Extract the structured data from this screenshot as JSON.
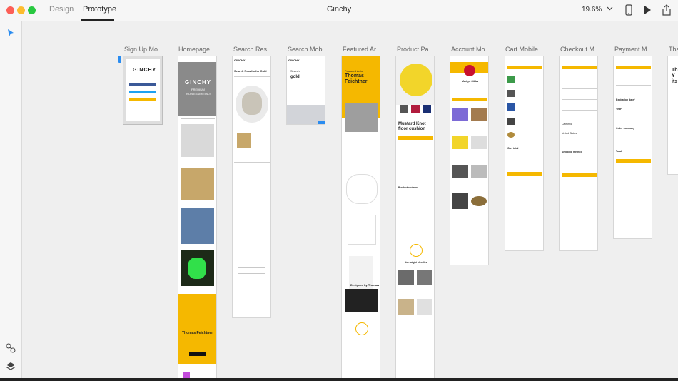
{
  "toolbar": {
    "design_tab": "Design",
    "prototype_tab": "Prototype",
    "document_title": "Ginchy",
    "zoom_level": "19.6%"
  },
  "icons": {
    "window_close": "red-circle",
    "window_minimize": "yellow-circle",
    "window_maximize": "green-circle",
    "zoom_dropdown": "chevron-down-icon",
    "device_preview": "phone-icon",
    "play": "play-icon",
    "share": "share-icon",
    "select_tool": "arrow-cursor-icon",
    "plugins": "plugins-icon",
    "layers": "layers-icon"
  },
  "artboards": [
    {
      "label": "Sign Up Mo...",
      "logo": "GINCHY"
    },
    {
      "label": "Homepage ...",
      "logo": "GINCHY",
      "hero": "GINCHY",
      "tagline": "PREMIUM",
      "tagline2": "NON-ESSENTIALS",
      "featured_name": "Thomas Feichtner"
    },
    {
      "label": "Search Res...",
      "logo": "GINCHY",
      "heading": "Search Results for Gold"
    },
    {
      "label": "Search Mob...",
      "logo": "GINCHY",
      "field_label": "Search",
      "query": "gold"
    },
    {
      "label": "Featured Ar...",
      "kicker": "Featured Artist",
      "name_line1": "Thomas",
      "name_line2": "Feichtner",
      "section": "Designed by Thomas"
    },
    {
      "label": "Product Pa...",
      "product_line1": "Mustard Knot",
      "product_line2": "floor cushion",
      "reviews": "Product reviews",
      "also_like": "You might also like"
    },
    {
      "label": "Account Mo...",
      "user_name": "Marilyn Gibbs"
    },
    {
      "label": "Cart Mobile",
      "total": "Cart total"
    },
    {
      "label": "Checkout M...",
      "country": "California",
      "state": "United States",
      "shipping": "Shipping method"
    },
    {
      "label": "Payment M...",
      "expiration": "Expiration date*",
      "year": "Year*",
      "summary": "Order summary",
      "total": "Total"
    },
    {
      "label": "Tha...",
      "heading_line1": "Th",
      "heading_line2": "Y",
      "heading_line3": "its"
    }
  ]
}
